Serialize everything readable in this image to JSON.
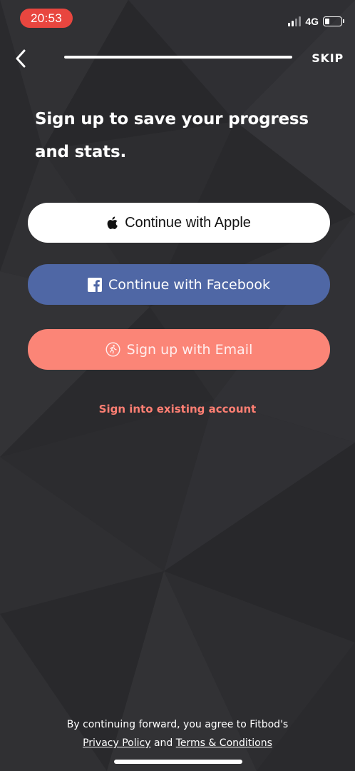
{
  "status_bar": {
    "time": "20:53",
    "network": "4G",
    "signal_bars_filled": 2,
    "signal_bars_total": 4,
    "battery_level": 0.3
  },
  "nav": {
    "back_icon": "chevron-left-icon",
    "progress": 1.0,
    "skip_label": "SKIP"
  },
  "heading": {
    "line1": "Sign up to save your progress",
    "line2": "and stats."
  },
  "buttons": {
    "apple_label": "Continue with Apple",
    "apple_icon": "apple-logo-icon",
    "facebook_label": "Continue with Facebook",
    "facebook_icon": "facebook-logo-icon",
    "email_label": "Sign up with Email",
    "email_icon": "running-person-icon"
  },
  "signin_link": "Sign into existing account",
  "footer": {
    "agreement_text": "By continuing forward, you agree to Fitbod's",
    "privacy_link": "Privacy Policy",
    "and_text": "and",
    "terms_link": "Terms & Conditions"
  },
  "colors": {
    "background": "#2b2b2e",
    "time_pill": "#e8463f",
    "facebook": "#4f67a5",
    "email": "#fb8577",
    "link": "#ff7f73"
  }
}
